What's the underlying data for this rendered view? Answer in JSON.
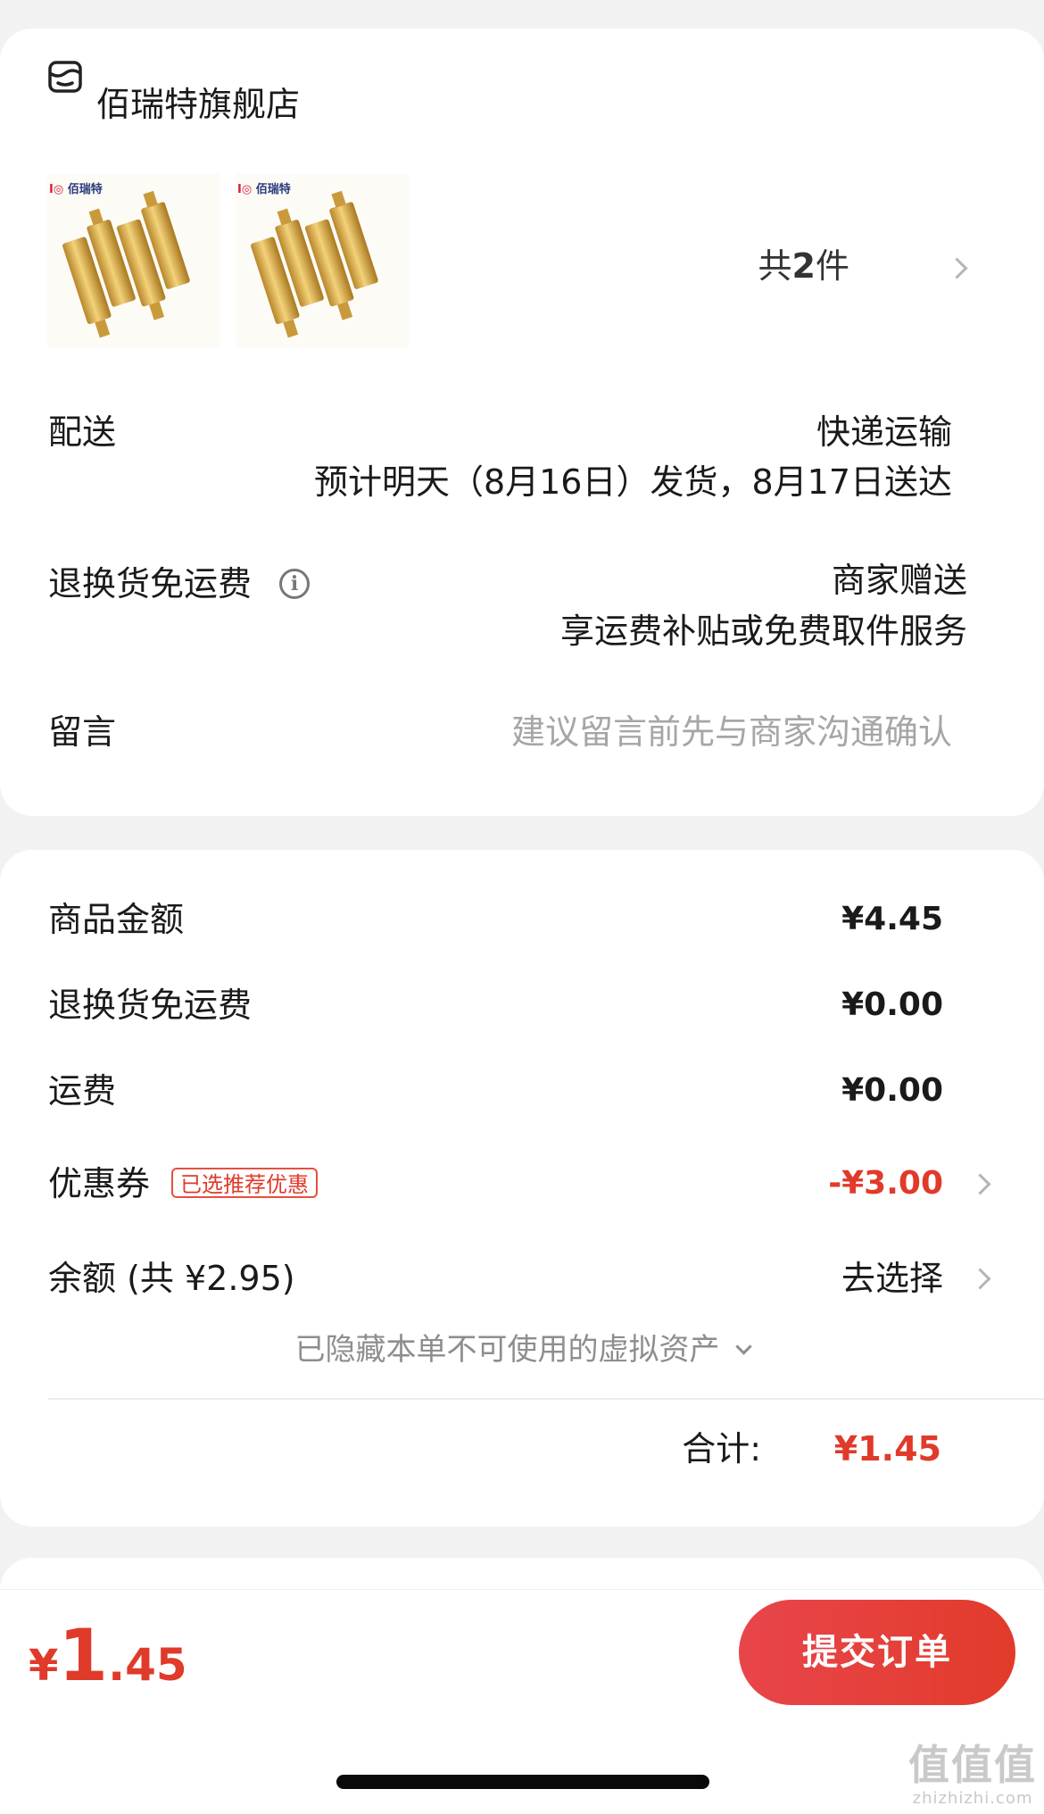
{
  "shop": {
    "name": "佰瑞特旗舰店",
    "thumb_brand": "佰瑞特",
    "item_count_prefix": "共",
    "item_count": "2",
    "item_count_suffix": "件"
  },
  "delivery": {
    "label": "配送",
    "method": "快递运输",
    "estimate": "预计明天（8月16日）发货，8月17日送达"
  },
  "return_shipping": {
    "label": "退换货免运费",
    "value": "商家赠送",
    "detail": "享运费补贴或免费取件服务"
  },
  "message": {
    "label": "留言",
    "placeholder": "建议留言前先与商家沟通确认"
  },
  "price": {
    "goods_label": "商品金额",
    "goods_value": "¥4.45",
    "return_label": "退换货免运费",
    "return_value": "¥0.00",
    "shipping_label": "运费",
    "shipping_value": "¥0.00",
    "coupon_label": "优惠券",
    "coupon_badge": "已选推荐优惠",
    "coupon_value": "-¥3.00",
    "balance_label": "余额 (共 ¥2.95)",
    "balance_action": "去选择",
    "hidden_assets": "已隐藏本单不可使用的虚拟资产",
    "total_label": "合计:",
    "total_value": "¥1.45"
  },
  "bottom": {
    "currency": "¥",
    "price_int": "1",
    "price_dec": ".45",
    "submit_label": "提交订单"
  },
  "watermark": {
    "big": "值值值",
    "small": "zhizhizhi.com"
  },
  "colors": {
    "accent": "#e03a2a",
    "button_gradient_start": "#e8454b",
    "button_gradient_end": "#e23b2b",
    "background": "#f2f2f2"
  }
}
